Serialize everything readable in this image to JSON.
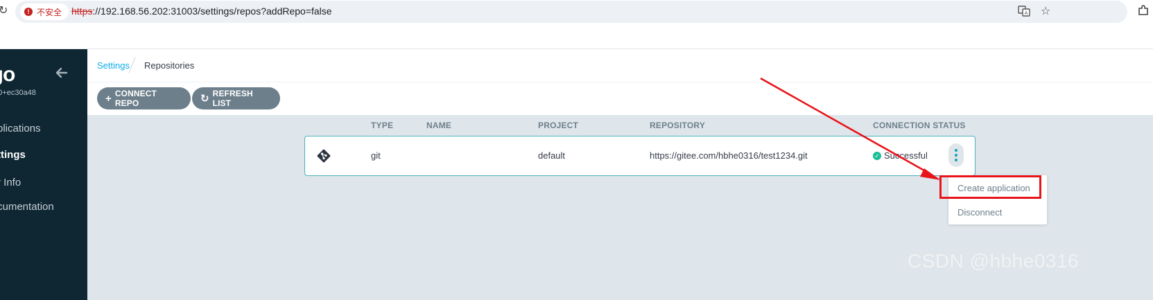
{
  "browser": {
    "security_label": "不安全",
    "url_scheme": "https",
    "url_rest": "://192.168.56.202:31003/settings/repos?addRepo=false",
    "icons": [
      "reload-icon",
      "translate-icon",
      "star-icon",
      "extensions-icon"
    ]
  },
  "sidebar": {
    "logo": "rgo",
    "version": "2.0+ec30a48",
    "items": [
      {
        "label": "plications",
        "active": false,
        "icon": "none"
      },
      {
        "label": "ttings",
        "active": true,
        "icon": "none"
      },
      {
        "label": "r Info",
        "active": false,
        "icon": "none"
      },
      {
        "label": "cumentation",
        "active": false,
        "icon": "none"
      }
    ]
  },
  "breadcrumb": {
    "parent": "Settings",
    "current": "Repositories"
  },
  "toolbar": {
    "connect_label": "CONNECT REPO",
    "refresh_label": "REFRESH LIST"
  },
  "table": {
    "headers": {
      "type": "TYPE",
      "name": "NAME",
      "project": "PROJECT",
      "repository": "REPOSITORY",
      "status": "CONNECTION STATUS"
    },
    "rows": [
      {
        "type": "git",
        "name": "",
        "project": "default",
        "repository": "https://gitee.com/hbhe0316/test1234.git",
        "status": "Successful",
        "status_color": "#18be94"
      }
    ]
  },
  "menu": {
    "items": [
      "Create application",
      "Disconnect"
    ]
  },
  "watermark": "CSDN @hbhe0316",
  "colors": {
    "sidebar_bg": "#0e2733",
    "accent": "#0dadea",
    "button_bg": "#6d7f8b",
    "annotation": "#e8141a"
  }
}
